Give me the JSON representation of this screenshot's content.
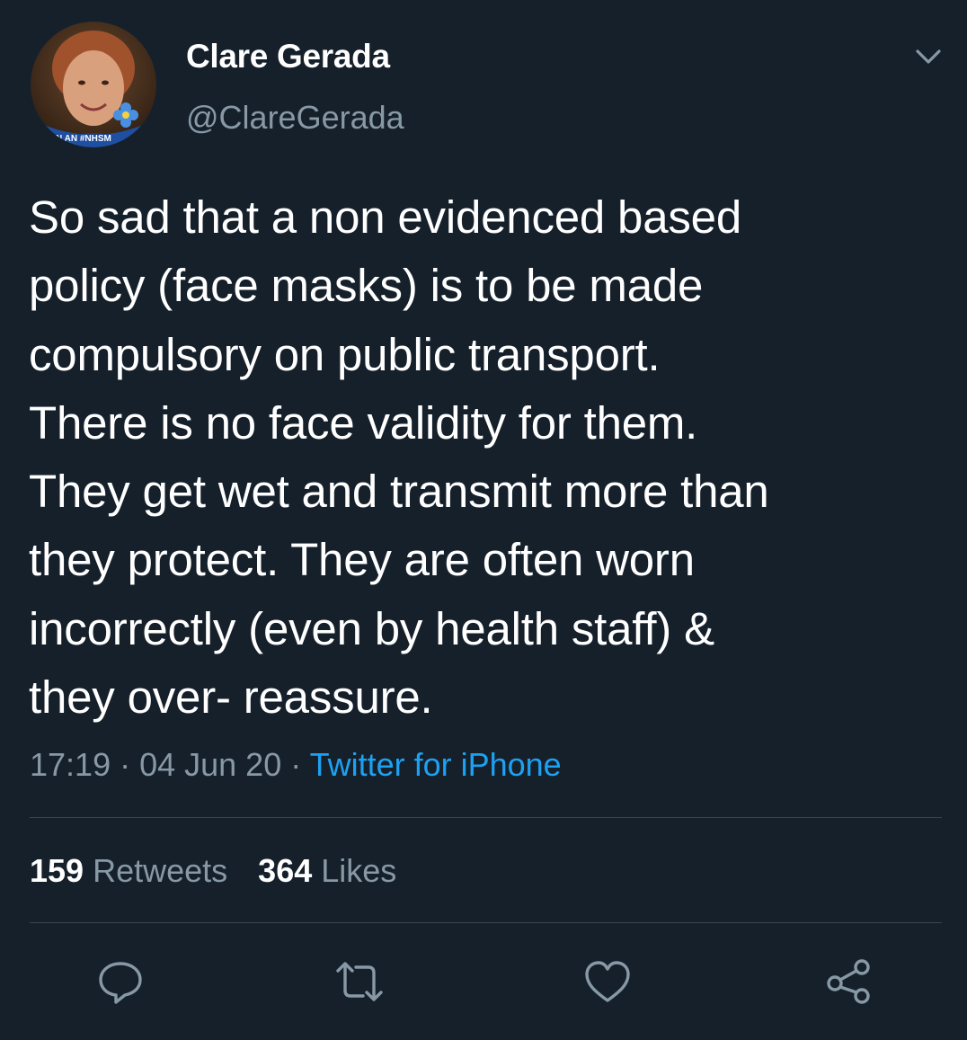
{
  "user": {
    "display_name": "Clare Gerada",
    "handle": "@ClareGerada",
    "avatar_banner_text": "N AN #NHSM"
  },
  "tweet": {
    "text_lines": [
      "So sad that a non evidenced based",
      "policy (face masks) is to be made",
      "compulsory on public transport.",
      "There is no face validity for them.",
      "They get wet and transmit more than",
      "they protect. They are often worn",
      "incorrectly (even by health staff) &",
      "they over- reassure."
    ],
    "time": "17:19",
    "separator": " · ",
    "date": "04 Jun 20",
    "source": "Twitter for iPhone"
  },
  "stats": {
    "retweets_count": "159",
    "retweets_label": "Retweets",
    "likes_count": "364",
    "likes_label": "Likes"
  },
  "actions": {
    "reply_icon": "reply-icon",
    "retweet_icon": "retweet-icon",
    "like_icon": "heart-icon",
    "share_icon": "share-icon"
  },
  "colors": {
    "background": "#15202b",
    "text": "#ffffff",
    "secondary": "#8899a6",
    "link": "#1da1f2",
    "divider": "#38444d"
  }
}
